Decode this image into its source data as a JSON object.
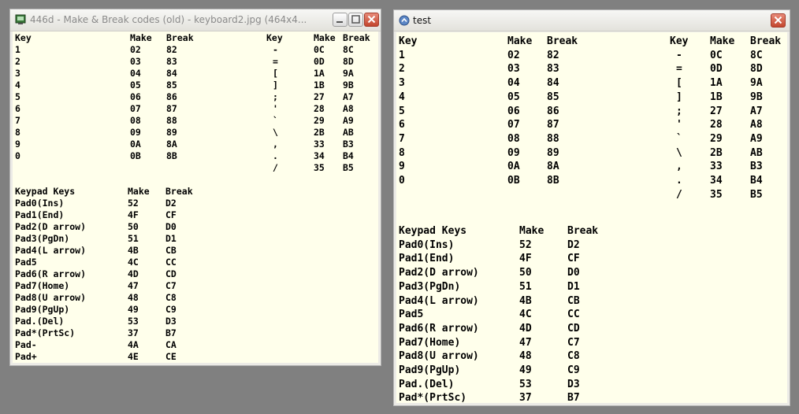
{
  "window1": {
    "title": "446d - Make & Break codes (old)  - keyboard2.jpg (464x4...",
    "icon": "app-icon",
    "buttons": [
      "minimize-icon",
      "maximize-icon",
      "close-icon"
    ]
  },
  "window2": {
    "title": "test",
    "icon": "app-icon",
    "buttons": [
      "close-icon"
    ]
  },
  "main_headers": [
    "Key",
    "Make",
    "Break"
  ],
  "main_rows": [
    [
      "1",
      "02",
      "82"
    ],
    [
      "2",
      "03",
      "83"
    ],
    [
      "3",
      "04",
      "84"
    ],
    [
      "4",
      "05",
      "85"
    ],
    [
      "5",
      "06",
      "86"
    ],
    [
      "6",
      "07",
      "87"
    ],
    [
      "7",
      "08",
      "88"
    ],
    [
      "8",
      "09",
      "89"
    ],
    [
      "9",
      "0A",
      "8A"
    ],
    [
      "0",
      "0B",
      "8B"
    ]
  ],
  "symbol_headers": [
    "Key",
    "Make",
    "Break"
  ],
  "symbol_rows": [
    [
      "-",
      "0C",
      "8C"
    ],
    [
      "=",
      "0D",
      "8D"
    ],
    [
      "[",
      "1A",
      "9A"
    ],
    [
      "]",
      "1B",
      "9B"
    ],
    [
      ";",
      "27",
      "A7"
    ],
    [
      "'",
      "28",
      "A8"
    ],
    [
      "`",
      "29",
      "A9"
    ],
    [
      "\\",
      "2B",
      "AB"
    ],
    [
      ",",
      "33",
      "B3"
    ],
    [
      ".",
      "34",
      "B4"
    ],
    [
      "/",
      "35",
      "B5"
    ]
  ],
  "keypad_headers": [
    "Keypad Keys",
    "Make",
    "Break"
  ],
  "keypad_rows": [
    [
      "Pad0(Ins)",
      "52",
      "D2"
    ],
    [
      "Pad1(End)",
      "4F",
      "CF"
    ],
    [
      "Pad2(D arrow)",
      "50",
      "D0"
    ],
    [
      "Pad3(PgDn)",
      "51",
      "D1"
    ],
    [
      "Pad4(L arrow)",
      "4B",
      "CB"
    ],
    [
      "Pad5",
      "4C",
      "CC"
    ],
    [
      "Pad6(R arrow)",
      "4D",
      "CD"
    ],
    [
      "Pad7(Home)",
      "47",
      "C7"
    ],
    [
      "Pad8(U arrow)",
      "48",
      "C8"
    ],
    [
      "Pad9(PgUp)",
      "49",
      "C9"
    ],
    [
      "Pad.(Del)",
      "53",
      "D3"
    ],
    [
      "Pad*(PrtSc)",
      "37",
      "B7"
    ],
    [
      "Pad-",
      "4A",
      "CA"
    ],
    [
      "Pad+",
      "4E",
      "CE"
    ]
  ]
}
